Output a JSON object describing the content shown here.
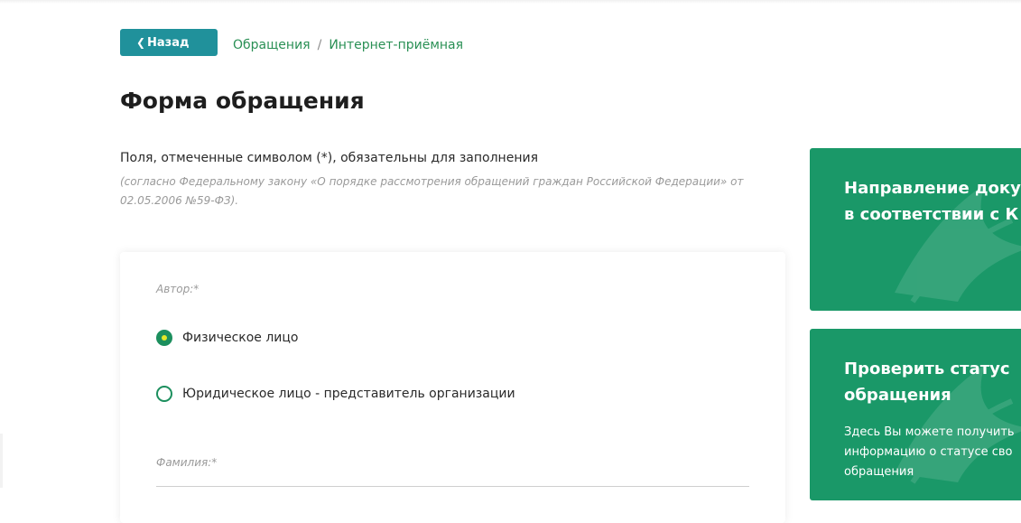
{
  "header": {
    "back_label": "Назад",
    "breadcrumbs": [
      "Обращения",
      "Интернет-приёмная"
    ],
    "breadcrumb_separator": "/"
  },
  "page": {
    "title": "Форма обращения",
    "required_note": "Поля, отмеченные символом (*), обязательны для заполнения",
    "law_note": "(согласно Федеральному закону «О порядке рассмотрения обращений граждан Российской Федерации» от 02.05.2006 №59-ФЗ)."
  },
  "form": {
    "author_label": "Автор:*",
    "author_options": [
      {
        "label": "Физическое лицо",
        "selected": true
      },
      {
        "label": "Юридическое лицо - представитель организации",
        "selected": false
      }
    ],
    "surname_label": "Фамилия:*"
  },
  "sidebar": {
    "card1": {
      "title_line1": "Направление доку",
      "title_line2": "в соответствии с К"
    },
    "card2": {
      "title_line1": "Проверить статус",
      "title_line2": "обращения",
      "text_line1": "Здесь Вы можете получить",
      "text_line2": "информацию о статусе сво",
      "text_line3": "обращения"
    }
  },
  "colors": {
    "accent_teal": "#20919b",
    "link_green": "#2a9055",
    "card_green": "#1a9868",
    "radio_green": "#1c8f5e",
    "radio_dot": "#e3e82a"
  }
}
